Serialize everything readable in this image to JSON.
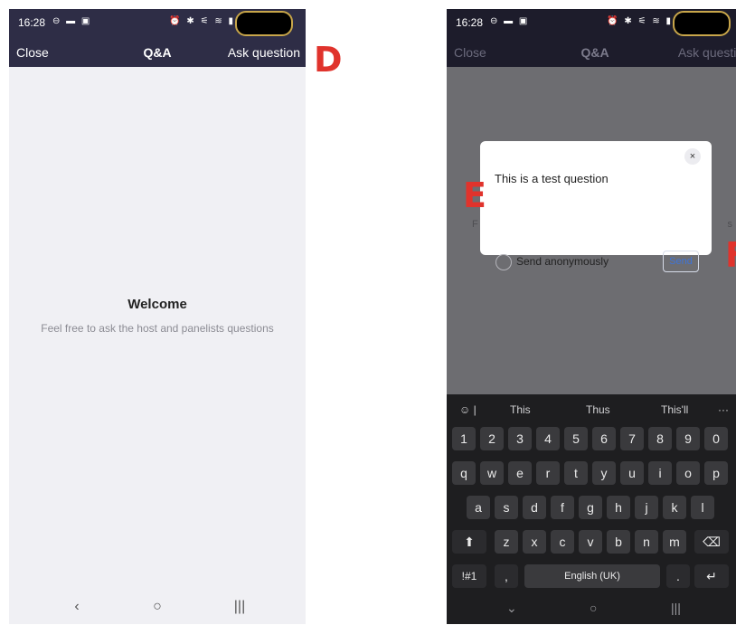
{
  "status": {
    "time": "16:28",
    "left_icons": "⊖ ▬ ▣",
    "right_icons": "⏰ ✱ ⚟ ≋ ▮"
  },
  "nav": {
    "close": "Close",
    "title": "Q&A",
    "ask": "Ask question"
  },
  "welcome": {
    "title": "Welcome",
    "subtitle": "Feel free to ask the host and panelists questions"
  },
  "sysnav": {
    "back": "‹",
    "home": "○",
    "recents": "|||"
  },
  "dialog": {
    "close": "×",
    "question": "This is a test question",
    "anonymous_label": "Send anonymously",
    "send": "Send",
    "bg_left": "F",
    "bg_right": "s"
  },
  "keyboard": {
    "emoji": "☺ |",
    "suggestions": [
      "This",
      "Thus",
      "This'll",
      "···"
    ],
    "row1": [
      "1",
      "2",
      "3",
      "4",
      "5",
      "6",
      "7",
      "8",
      "9",
      "0"
    ],
    "row2": [
      "q",
      "w",
      "e",
      "r",
      "t",
      "y",
      "u",
      "i",
      "o",
      "p"
    ],
    "row3": [
      "a",
      "s",
      "d",
      "f",
      "g",
      "h",
      "j",
      "k",
      "l"
    ],
    "row4": [
      "⬆",
      "z",
      "x",
      "c",
      "v",
      "b",
      "n",
      "m",
      "⌫"
    ],
    "symbols": "!#1",
    "comma": ",",
    "space": "English (UK)",
    "period": ".",
    "enter": "↵",
    "nav": [
      "⌄",
      "○",
      "|||"
    ]
  },
  "annotations": {
    "d": "D",
    "e": "E",
    "f": "F"
  },
  "colors": {
    "header": "#2e2d46",
    "header_dim": "#1d1c2b",
    "accent": "#3f74d8",
    "annotation": "#e0332c",
    "content_bg": "#f0f0f4",
    "keyboard_bg": "#1e1e20"
  }
}
